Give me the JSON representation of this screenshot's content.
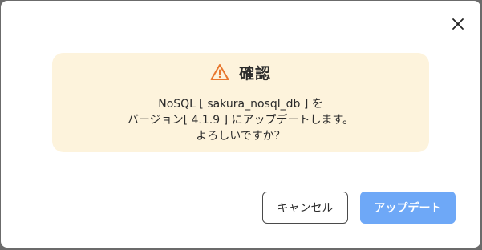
{
  "dialog": {
    "close_icon": "close-icon",
    "confirm": {
      "icon": "warning-icon",
      "icon_color": "#e8772e",
      "title": "確認",
      "message_line1": "NoSQL [ sakura_nosql_db ] を",
      "message_line2": "バージョン[ 4.1.9 ] にアップデートします。",
      "message_line3": "よろしいですか？",
      "background_color": "#fdf3dc"
    },
    "buttons": {
      "cancel_label": "キャンセル",
      "update_label": "アップデート",
      "update_color": "#6ea8f7"
    }
  }
}
